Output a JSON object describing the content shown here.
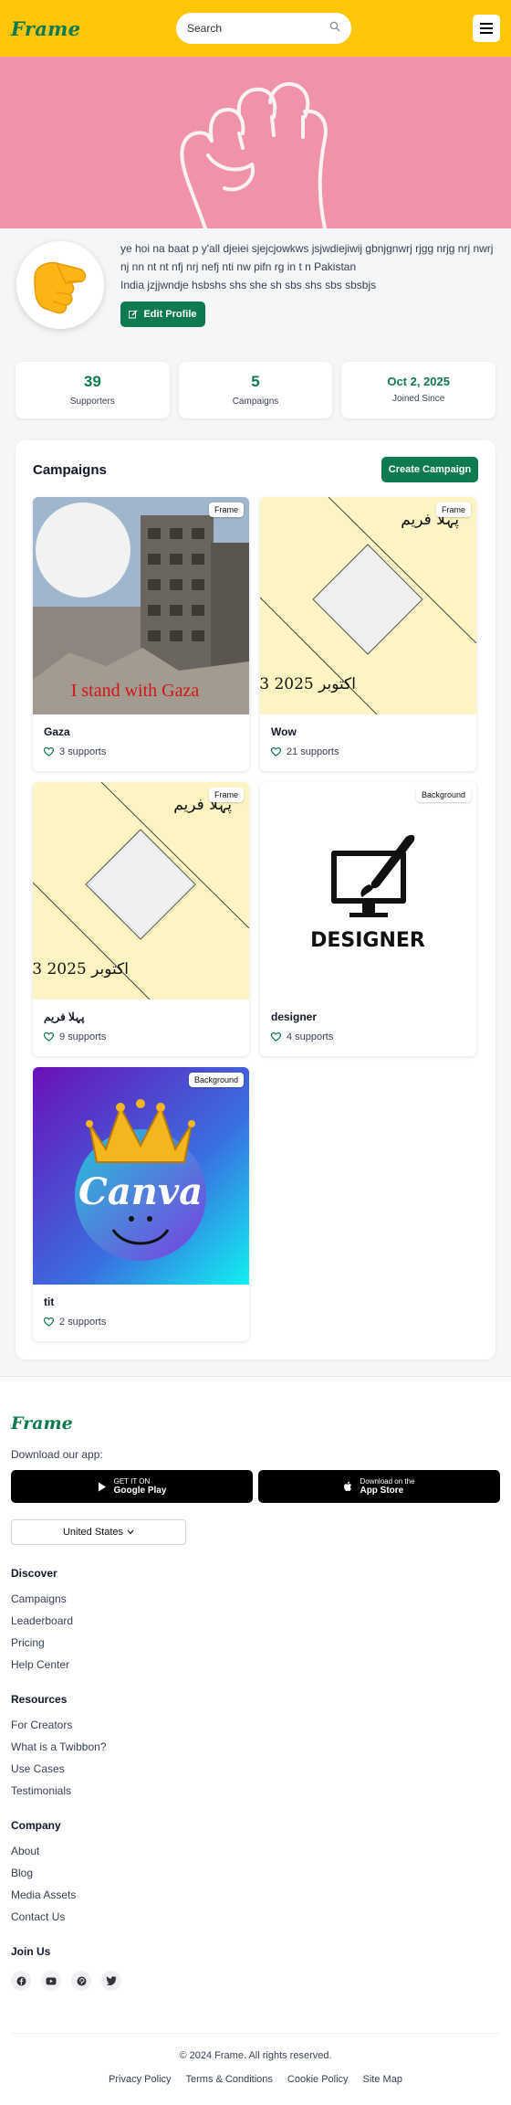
{
  "header": {
    "logo": "Frame",
    "search_placeholder": "Search"
  },
  "profile": {
    "bio": "ye hoi na baat p y'all djeiei sjejcjowkws jsjwdiejiwij gbnjgnwrj rjgg nrjg nrj nwrj nj nn nt nt nfj nrj nefj nti nw pifn rg in t n Pakistan",
    "bio_line2": "India jzjjwndje hsbshs shs she sh sbs shs sbs sbsbjs",
    "edit_label": "Edit Profile"
  },
  "stats": [
    {
      "value": "39",
      "label": "Supporters"
    },
    {
      "value": "5",
      "label": "Campaigns"
    },
    {
      "value": "Oct 2, 2025",
      "label": "Joined Since"
    }
  ],
  "campaigns": {
    "title": "Campaigns",
    "create_label": "Create Campaign",
    "items": [
      {
        "title": "Gaza",
        "supports": "3 supports",
        "badge": "Frame",
        "overlay": "I stand with Gaza"
      },
      {
        "title": "Wow",
        "supports": "21 supports",
        "badge": "Frame",
        "urdu_top": "پہلا فریم",
        "urdu_date": "3 اکتوبر 2025"
      },
      {
        "title": "پہلا فریم",
        "supports": "9 supports",
        "badge": "Frame",
        "urdu_top": "پہلا فریم",
        "urdu_date": "3 اکتوبر 2025"
      },
      {
        "title": "designer",
        "supports": "4 supports",
        "badge": "Background",
        "overlay": "DESIGNER"
      },
      {
        "title": "tit",
        "supports": "2 supports",
        "badge": "Background",
        "overlay": "Canva"
      }
    ]
  },
  "footer": {
    "logo": "Frame",
    "download_label": "Download our app:",
    "google_small": "GET IT ON",
    "google_big": "Google Play",
    "apple_small": "Download on the",
    "apple_big": "App Store",
    "country": "United States",
    "sections": [
      {
        "title": "Discover",
        "links": [
          "Campaigns",
          "Leaderboard",
          "Pricing",
          "Help Center"
        ]
      },
      {
        "title": "Resources",
        "links": [
          "For Creators",
          "What is a Twibbon?",
          "Use Cases",
          "Testimonials"
        ]
      },
      {
        "title": "Company",
        "links": [
          "About",
          "Blog",
          "Media Assets",
          "Contact Us"
        ]
      }
    ],
    "join_title": "Join Us",
    "copyright": "© 2024 Frame. All rights reserved.",
    "legal": [
      "Privacy Policy",
      "Terms & Conditions",
      "Cookie Policy",
      "Site Map"
    ]
  },
  "colors": {
    "brand_yellow": "#fec606",
    "brand_green": "#0f7a4f",
    "banner_pink": "#f093a8"
  }
}
